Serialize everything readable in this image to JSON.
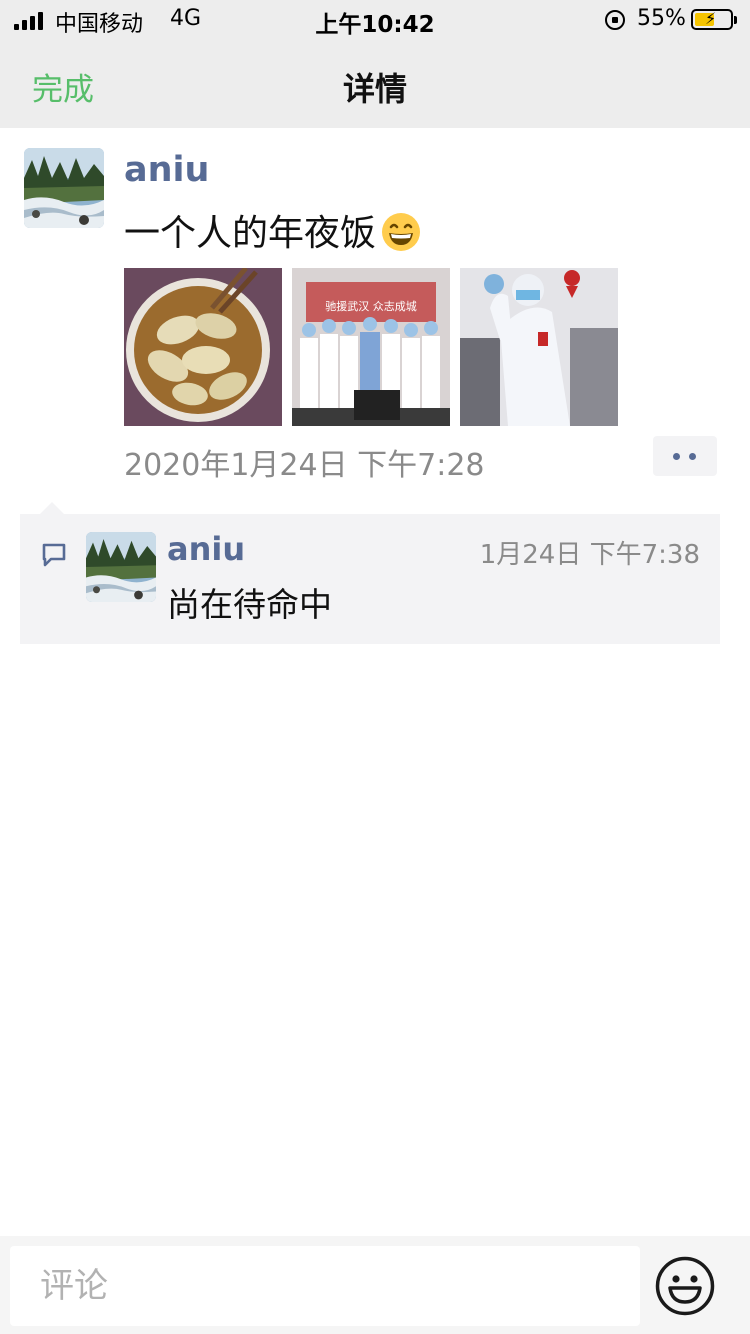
{
  "status_bar": {
    "carrier": "中国移动",
    "network": "4G",
    "time": "上午10:42",
    "battery_percent": "55%",
    "battery_level": 0.55,
    "battery_color": "#f5c400"
  },
  "nav": {
    "back_label": "完成",
    "title": "详情"
  },
  "post": {
    "author": "aniu",
    "text": "一个人的年夜饭",
    "emoji": "grinning-face-icon",
    "photos": [
      "dumplings-photo",
      "medical-team-photo",
      "protective-suit-photo"
    ],
    "photo_caption_text": "驰援武汉 众志成城",
    "timestamp": "2020年1月24日 下午7:28",
    "more_icon": "more-dots-icon"
  },
  "comments": [
    {
      "author": "aniu",
      "time": "1月24日 下午7:38",
      "text": "尚在待命中"
    }
  ],
  "comment_bar": {
    "placeholder": "评论",
    "emoji_icon": "emoji-smiley-icon"
  },
  "colors": {
    "link_name": "#576b95",
    "nav_action": "#57be6a",
    "timestamp": "#8a8a8a",
    "comment_bg": "#f3f3f5"
  }
}
